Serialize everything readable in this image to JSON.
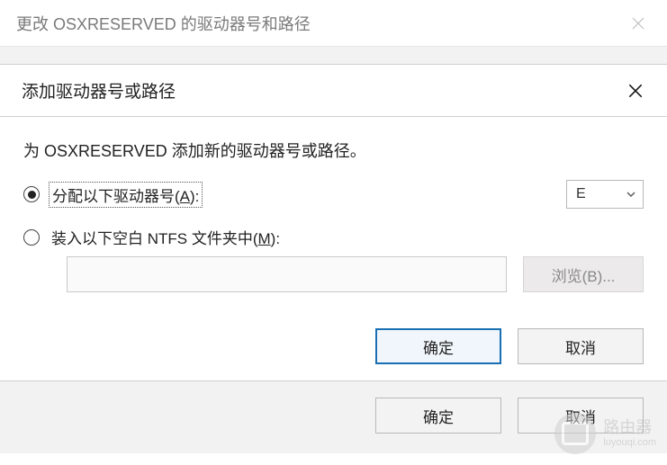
{
  "outer": {
    "title": "更改 OSXRESERVED 的驱动器号和路径",
    "ok_label": "确定",
    "cancel_label": "取消"
  },
  "inner": {
    "title": "添加驱动器号或路径",
    "instruction": "为 OSXRESERVED 添加新的驱动器号或路径。",
    "assign_label_pre": "分配以下驱动器号(",
    "assign_label_hotkey": "A",
    "assign_label_post": "):",
    "mount_label_pre": "装入以下空白 NTFS 文件夹中(",
    "mount_label_hotkey": "M",
    "mount_label_post": "):",
    "drive_letter": "E",
    "path_value": "",
    "browse_label": "浏览(B)...",
    "ok_label": "确定",
    "cancel_label": "取消",
    "selected_option": "assign"
  },
  "watermark": {
    "cn": "路由器",
    "domain": "luyouqi.com"
  }
}
